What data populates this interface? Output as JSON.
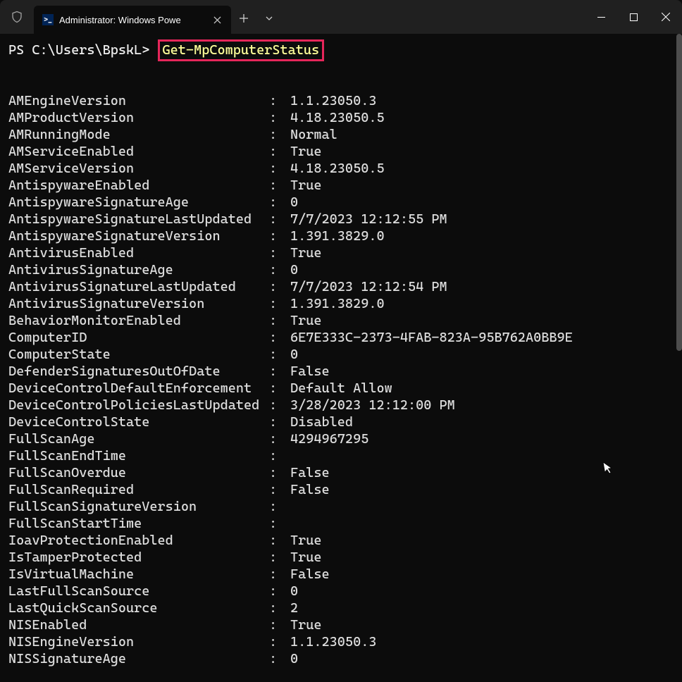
{
  "titlebar": {
    "tab_title": "Administrator: Windows Powe",
    "ps_glyph": ">_"
  },
  "prompt": {
    "text": "PS C:\\Users\\BpskL>",
    "command": "Get-MpComputerStatus"
  },
  "properties": [
    {
      "key": "AMEngineVersion",
      "val": "1.1.23050.3"
    },
    {
      "key": "AMProductVersion",
      "val": "4.18.23050.5"
    },
    {
      "key": "AMRunningMode",
      "val": "Normal"
    },
    {
      "key": "AMServiceEnabled",
      "val": "True"
    },
    {
      "key": "AMServiceVersion",
      "val": "4.18.23050.5"
    },
    {
      "key": "AntispywareEnabled",
      "val": "True"
    },
    {
      "key": "AntispywareSignatureAge",
      "val": "0"
    },
    {
      "key": "AntispywareSignatureLastUpdated",
      "val": "7/7/2023 12:12:55 PM"
    },
    {
      "key": "AntispywareSignatureVersion",
      "val": "1.391.3829.0"
    },
    {
      "key": "AntivirusEnabled",
      "val": "True"
    },
    {
      "key": "AntivirusSignatureAge",
      "val": "0"
    },
    {
      "key": "AntivirusSignatureLastUpdated",
      "val": "7/7/2023 12:12:54 PM"
    },
    {
      "key": "AntivirusSignatureVersion",
      "val": "1.391.3829.0"
    },
    {
      "key": "BehaviorMonitorEnabled",
      "val": "True"
    },
    {
      "key": "ComputerID",
      "val": "6E7E333C-2373-4FAB-823A-95B762A0BB9E"
    },
    {
      "key": "ComputerState",
      "val": "0"
    },
    {
      "key": "DefenderSignaturesOutOfDate",
      "val": "False"
    },
    {
      "key": "DeviceControlDefaultEnforcement",
      "val": "Default Allow"
    },
    {
      "key": "DeviceControlPoliciesLastUpdated",
      "val": "3/28/2023 12:12:00 PM"
    },
    {
      "key": "DeviceControlState",
      "val": "Disabled"
    },
    {
      "key": "FullScanAge",
      "val": "4294967295"
    },
    {
      "key": "FullScanEndTime",
      "val": ""
    },
    {
      "key": "FullScanOverdue",
      "val": "False"
    },
    {
      "key": "FullScanRequired",
      "val": "False"
    },
    {
      "key": "FullScanSignatureVersion",
      "val": ""
    },
    {
      "key": "FullScanStartTime",
      "val": ""
    },
    {
      "key": "IoavProtectionEnabled",
      "val": "True"
    },
    {
      "key": "IsTamperProtected",
      "val": "True"
    },
    {
      "key": "IsVirtualMachine",
      "val": "False"
    },
    {
      "key": "LastFullScanSource",
      "val": "0"
    },
    {
      "key": "LastQuickScanSource",
      "val": "2"
    },
    {
      "key": "NISEnabled",
      "val": "True"
    },
    {
      "key": "NISEngineVersion",
      "val": "1.1.23050.3"
    },
    {
      "key": "NISSignatureAge",
      "val": "0"
    }
  ]
}
